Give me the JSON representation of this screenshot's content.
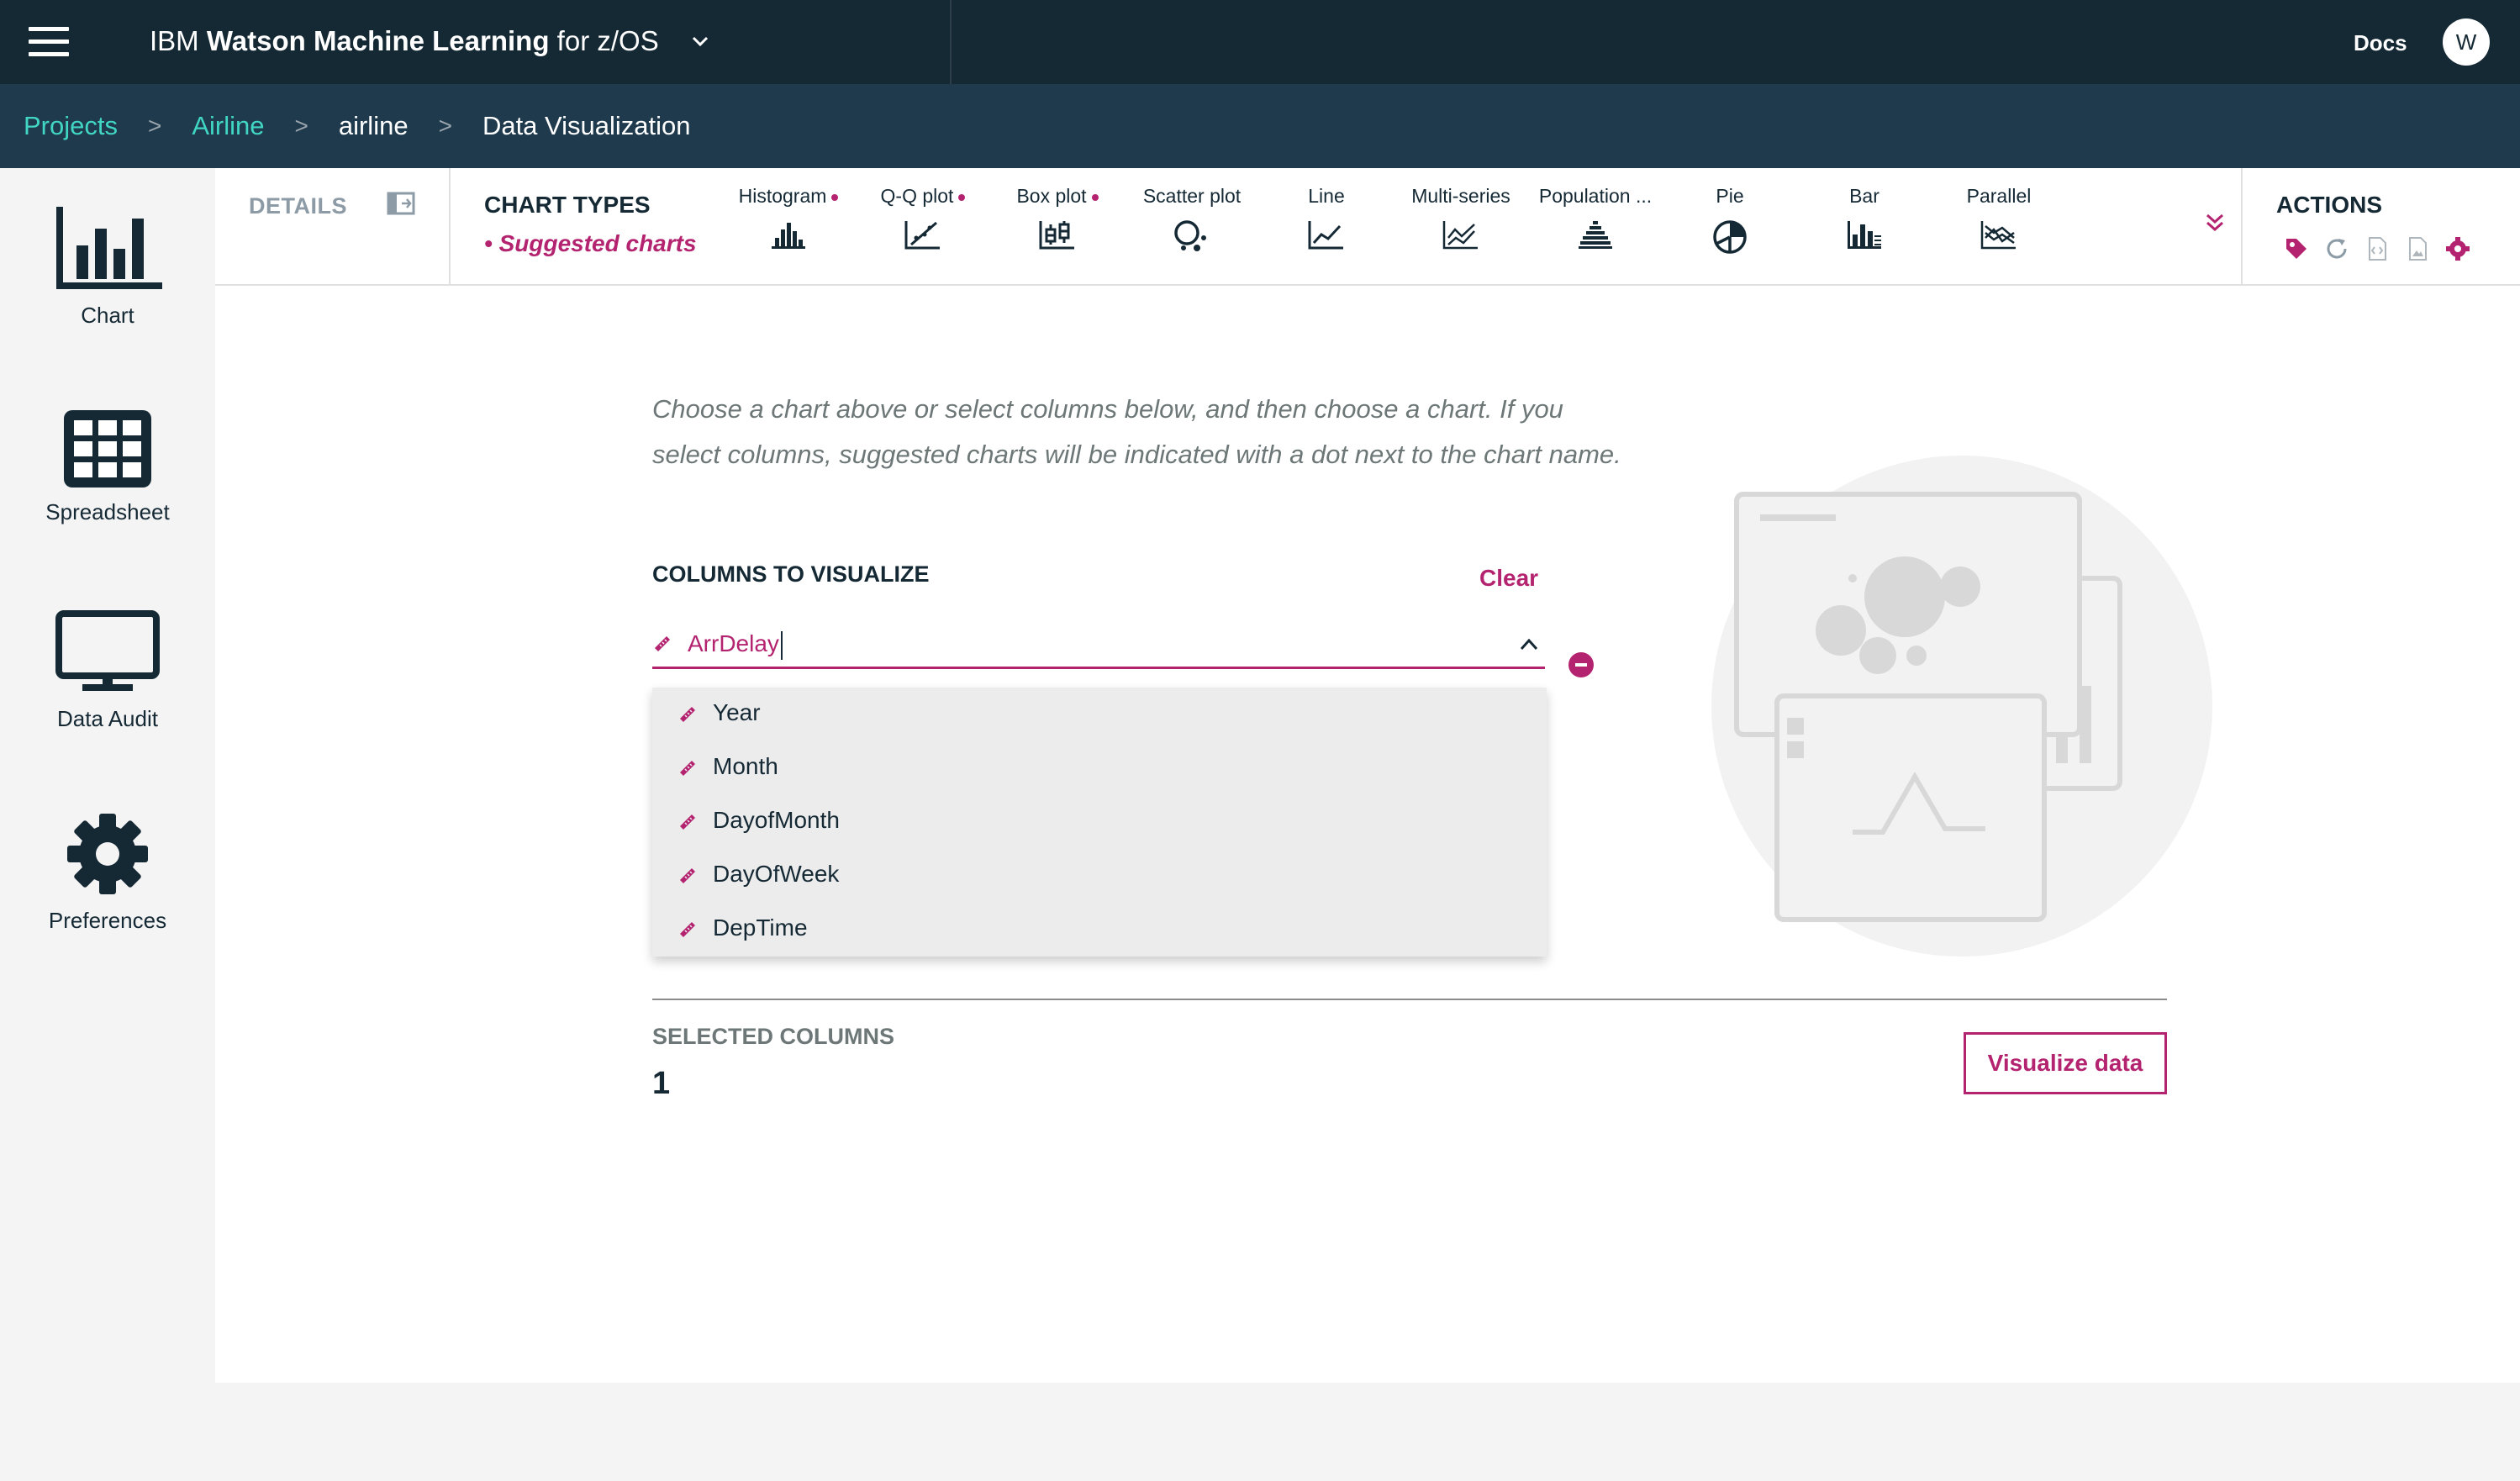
{
  "topbar": {
    "brand_prefix": "IBM",
    "brand_name": "Watson Machine Learning",
    "brand_suffix": "for z/OS",
    "docs_label": "Docs",
    "avatar_initial": "W"
  },
  "breadcrumb": {
    "items": [
      "Projects",
      "Airline",
      "airline",
      "Data Visualization"
    ],
    "separator": ">"
  },
  "sidebar": {
    "items": [
      {
        "label": "Chart",
        "icon": "bar-chart-icon"
      },
      {
        "label": "Spreadsheet",
        "icon": "grid-icon"
      },
      {
        "label": "Data Audit",
        "icon": "monitor-icon"
      },
      {
        "label": "Preferences",
        "icon": "gear-icon"
      }
    ]
  },
  "toolbar": {
    "details_label": "DETAILS",
    "chart_types_label": "CHART TYPES",
    "suggested_label": "• Suggested charts",
    "chart_types": [
      {
        "label": "Histogram",
        "suggested": true,
        "icon": "histogram-icon"
      },
      {
        "label": "Q-Q plot",
        "suggested": true,
        "icon": "qq-plot-icon"
      },
      {
        "label": "Box plot",
        "suggested": true,
        "icon": "box-plot-icon"
      },
      {
        "label": "Scatter plot",
        "suggested": false,
        "icon": "scatter-plot-icon"
      },
      {
        "label": "Line",
        "suggested": false,
        "icon": "line-chart-icon"
      },
      {
        "label": "Multi-series",
        "suggested": false,
        "icon": "multi-series-icon"
      },
      {
        "label": "Population ...",
        "suggested": false,
        "icon": "population-pyramid-icon"
      },
      {
        "label": "Pie",
        "suggested": false,
        "icon": "pie-chart-icon"
      },
      {
        "label": "Bar",
        "suggested": false,
        "icon": "bar-icon"
      },
      {
        "label": "Parallel",
        "suggested": false,
        "icon": "parallel-icon"
      }
    ],
    "actions_label": "ACTIONS",
    "actions": [
      "tag-icon",
      "refresh-icon",
      "code-file-icon",
      "image-file-icon",
      "settings-icon"
    ]
  },
  "content": {
    "instructions": "Choose a chart above or select columns below, and then choose a chart. If you select columns, suggested charts will be indicated with a dot next to the chart name.",
    "columns_title": "COLUMNS TO VISUALIZE",
    "clear_label": "Clear",
    "column_value": "ArrDelay",
    "dropdown_options": [
      "Year",
      "Month",
      "DayofMonth",
      "DayOfWeek",
      "DepTime"
    ],
    "selected_title": "SELECTED COLUMNS",
    "selected_count": "1",
    "visualize_label": "Visualize data"
  },
  "colors": {
    "nav_dark": "#152935",
    "breadcrumb_bg": "#1f3a4d",
    "accent_magenta": "#b4236f",
    "link_teal": "#41d6c3"
  }
}
